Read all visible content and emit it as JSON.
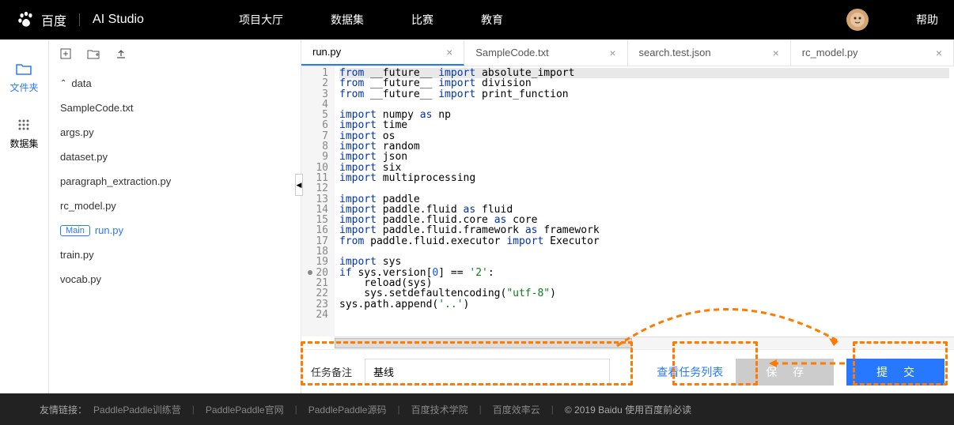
{
  "header": {
    "brand1": "百度",
    "brand2": "AI Studio",
    "nav": [
      "项目大厅",
      "数据集",
      "比赛",
      "教育"
    ],
    "help": "帮助"
  },
  "leftcol": {
    "files": "文件夹",
    "datasets": "数据集"
  },
  "filetree": {
    "folder": "data",
    "files": [
      "SampleCode.txt",
      "args.py",
      "dataset.py",
      "paragraph_extraction.py",
      "rc_model.py",
      "run.py",
      "train.py",
      "vocab.py"
    ],
    "main_badge": "Main",
    "active": "run.py"
  },
  "tabs": [
    {
      "label": "run.py",
      "active": true
    },
    {
      "label": "SampleCode.txt",
      "active": false
    },
    {
      "label": "search.test.json",
      "active": false
    },
    {
      "label": "rc_model.py",
      "active": false
    }
  ],
  "code": {
    "lines": [
      {
        "n": 1,
        "html": "<span class='kw-from'>from</span> __future__ <span class='kw-import'>import</span> absolute_import"
      },
      {
        "n": 2,
        "html": "<span class='kw-from'>from</span> __future__ <span class='kw-import'>import</span> division"
      },
      {
        "n": 3,
        "html": "<span class='kw-from'>from</span> __future__ <span class='kw-import'>import</span> print_function"
      },
      {
        "n": 4,
        "html": ""
      },
      {
        "n": 5,
        "html": "<span class='kw-import'>import</span> numpy <span class='kw-as'>as</span> np"
      },
      {
        "n": 6,
        "html": "<span class='kw-import'>import</span> time"
      },
      {
        "n": 7,
        "html": "<span class='kw-import'>import</span> os"
      },
      {
        "n": 8,
        "html": "<span class='kw-import'>import</span> random"
      },
      {
        "n": 9,
        "html": "<span class='kw-import'>import</span> json"
      },
      {
        "n": 10,
        "html": "<span class='kw-import'>import</span> six"
      },
      {
        "n": 11,
        "html": "<span class='kw-import'>import</span> multiprocessing"
      },
      {
        "n": 12,
        "html": ""
      },
      {
        "n": 13,
        "html": "<span class='kw-import'>import</span> paddle"
      },
      {
        "n": 14,
        "html": "<span class='kw-import'>import</span> paddle.fluid <span class='kw-as'>as</span> fluid"
      },
      {
        "n": 15,
        "html": "<span class='kw-import'>import</span> paddle.fluid.core <span class='kw-as'>as</span> core"
      },
      {
        "n": 16,
        "html": "<span class='kw-import'>import</span> paddle.fluid.framework <span class='kw-as'>as</span> framework"
      },
      {
        "n": 17,
        "html": "<span class='kw-from'>from</span> paddle.fluid.executor <span class='kw-import'>import</span> Executor"
      },
      {
        "n": 18,
        "html": ""
      },
      {
        "n": 19,
        "html": "<span class='kw-import'>import</span> sys"
      },
      {
        "n": 20,
        "html": "<span class='kw-if'>if</span> sys.version[<span class='num'>0</span>] == <span class='str'>'2'</span>:",
        "bp": true
      },
      {
        "n": 21,
        "html": "    reload(sys)"
      },
      {
        "n": 22,
        "html": "    sys.setdefaultencoding(<span class='str'>\"utf-8\"</span>)"
      },
      {
        "n": 23,
        "html": "sys.path.append(<span class='str'>'..'</span>)"
      },
      {
        "n": 24,
        "html": ""
      }
    ]
  },
  "bottom": {
    "task_label": "任务备注",
    "task_value": "基线",
    "view_tasks": "查看任务列表",
    "save": "保 存",
    "submit": "提 交"
  },
  "footer": {
    "prefix": "友情链接：",
    "links": [
      "PaddlePaddle训练营",
      "PaddlePaddle官网",
      "PaddlePaddle源码",
      "百度技术学院",
      "百度效率云"
    ],
    "copyright": "© 2019 Baidu 使用百度前必读"
  }
}
